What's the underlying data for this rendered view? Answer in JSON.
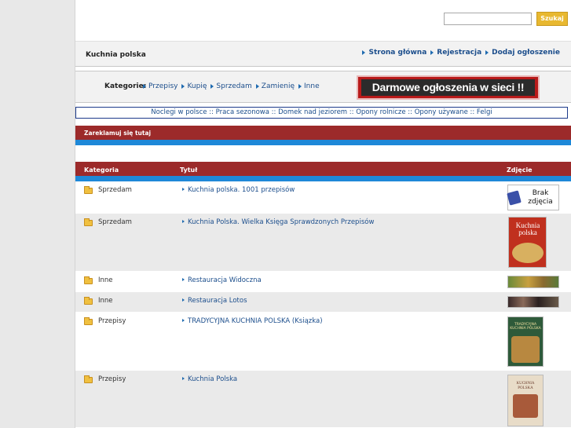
{
  "search": {
    "placeholder": "",
    "button_label": "Szukaj"
  },
  "header": {
    "site_title": "Kuchnia polska"
  },
  "topnav": [
    {
      "label": "Strona główna"
    },
    {
      "label": "Rejestracja"
    },
    {
      "label": "Dodaj ogłoszenie"
    }
  ],
  "categories": {
    "label": "Kategorie:",
    "items": [
      {
        "label": "Przepisy"
      },
      {
        "label": "Kupię"
      },
      {
        "label": "Sprzedam"
      },
      {
        "label": "Zamienię"
      },
      {
        "label": "Inne"
      }
    ]
  },
  "banner": {
    "text": "Darmowe ogłoszenia w sieci !!"
  },
  "linkbar": {
    "text": "Noclegi w polsce :: Praca sezonowa :: Domek nad jeziorem :: Opony rolnicze :: Opony używane :: Felgi"
  },
  "promo": {
    "text": "Zareklamuj się tutaj"
  },
  "table": {
    "headers": {
      "category": "Kategoria",
      "title": "Tytuł",
      "photo": "Zdjęcie"
    },
    "rows": [
      {
        "category": "Sprzedam",
        "title": "Kuchnia polska. 1001 przepisów",
        "photo": "no-photo"
      },
      {
        "category": "Sprzedam",
        "title": "Kuchnia Polska. Wielka Księga Sprawdzonych Przepisów",
        "photo": "book-cover-kuchnia-polska"
      },
      {
        "category": "Inne",
        "title": "Restauracja Widoczna",
        "photo": "restaurant-photo"
      },
      {
        "category": "Inne",
        "title": "Restauracja Lotos",
        "photo": "restaurant-photo"
      },
      {
        "category": "Przepisy",
        "title": "TRADYCYJNA KUCHNIA POLSKA (Ksiązka)",
        "photo": "book-cover-tradycyjna"
      },
      {
        "category": "Przepisy",
        "title": "Kuchnia Polska",
        "photo": "book-cover-kuchnia-polska-beige"
      }
    ],
    "no_photo_text": "Brak zdjęcia",
    "book1_cover_text": "Kuchnia polska",
    "book3_cover_text": "TRADYCYJNA KUCHNIA POLSKA",
    "book4_cover_text": "KUCHNIA POLSKA"
  },
  "colors": {
    "header_red": "#9c2a2a",
    "accent_blue": "#1e88d8",
    "link_blue": "#1c4e8c",
    "search_button": "#e8b830"
  }
}
